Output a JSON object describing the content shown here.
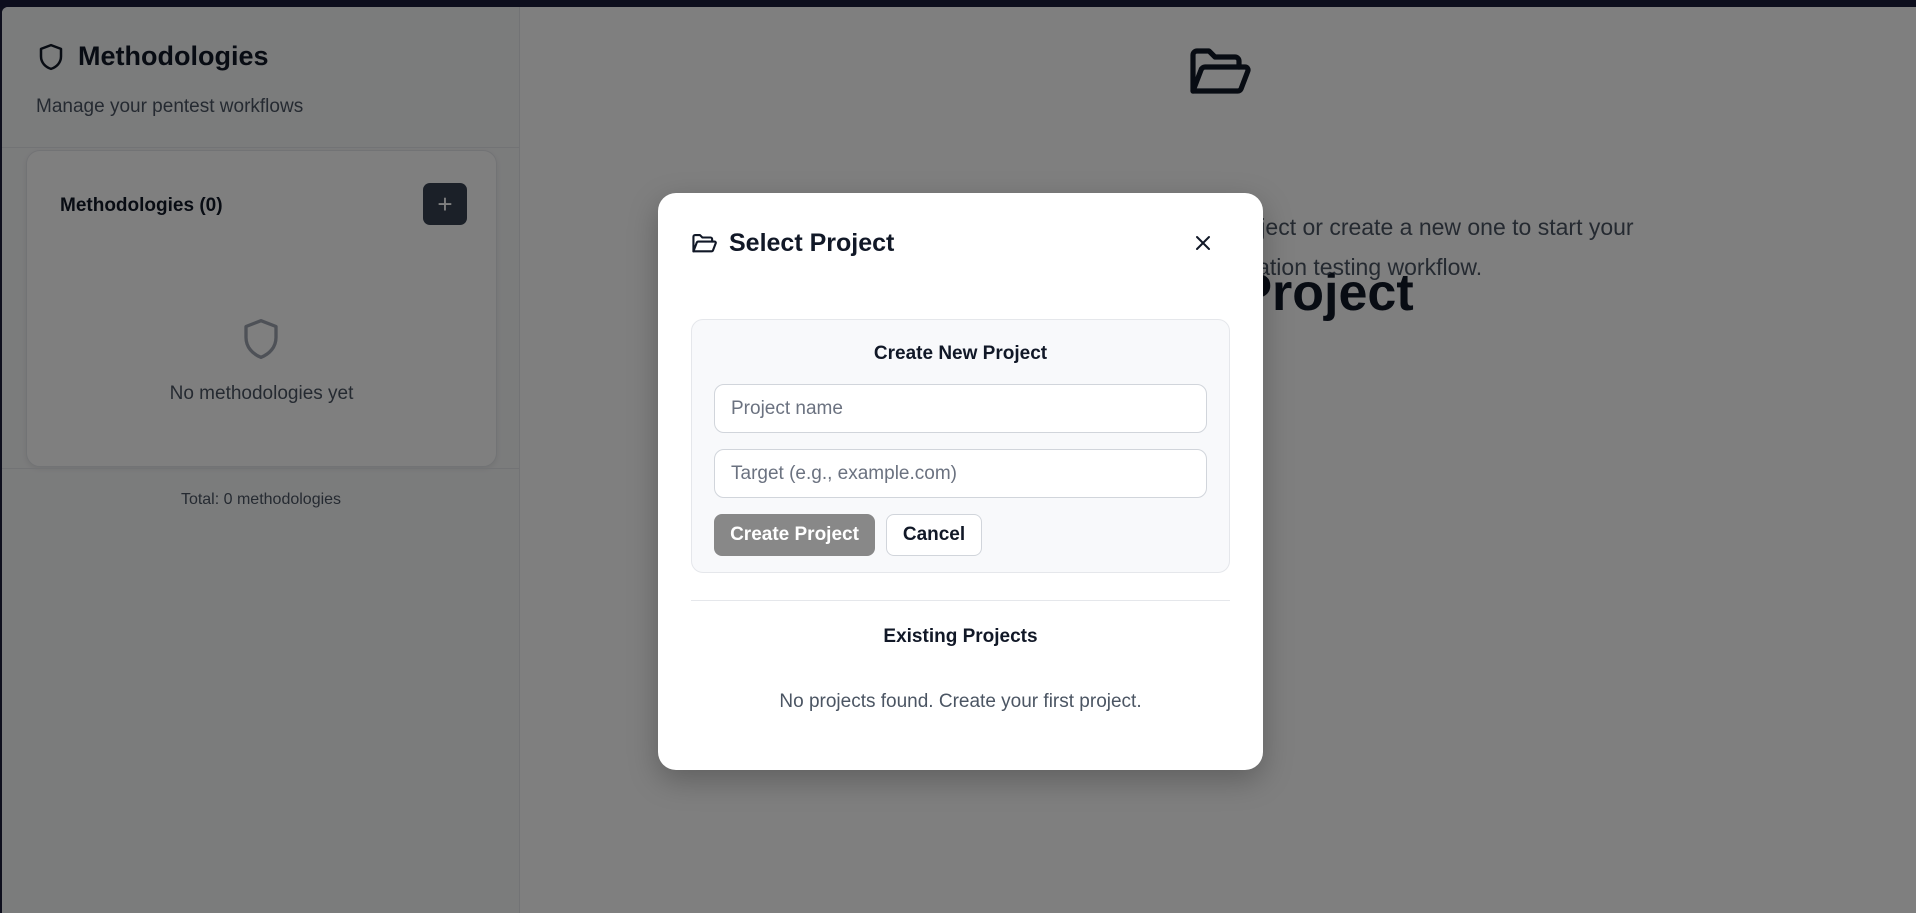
{
  "sidebar": {
    "title": "Methodologies",
    "subtitle": "Manage your pentest workflows",
    "card_title": "Methodologies (0)",
    "add_label": "+",
    "empty_text": "No methodologies yet",
    "total": "Total: 0 methodologies",
    "icon": "shield-icon"
  },
  "main": {
    "title": "Select a Project",
    "description": "Select an existing project or create a new one to start your penetration testing workflow.",
    "icon": "folder-open-icon"
  },
  "modal": {
    "title": "Select Project",
    "icon": "folder-open-icon",
    "close_icon": "close-icon",
    "create_section_title": "Create New Project",
    "project_name_placeholder": "Project name",
    "target_placeholder": "Target (e.g., example.com)",
    "project_name_value": "",
    "target_value": "",
    "create_button": "Create Project",
    "cancel_button": "Cancel",
    "existing_title": "Existing Projects",
    "no_projects_text": "No projects found. Create your first project."
  },
  "colors": {
    "overlay": "rgba(0,0,0,0.5)",
    "add_button_bg": "#374151",
    "create_button_bg": "#888888",
    "topbar": "#1b1d3b"
  }
}
